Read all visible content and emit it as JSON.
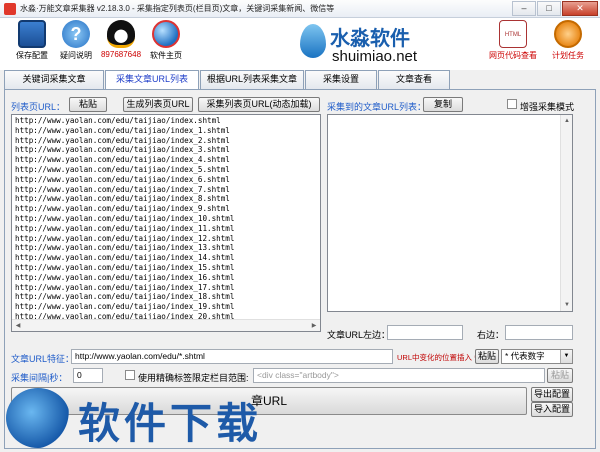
{
  "window": {
    "title": "水淼·万能文章采集器 v2.18.3.0 - 采集指定列表页(栏目页)文章，关键词采集新闻、微信等",
    "minimize": "–",
    "maximize": "□",
    "close": "✕"
  },
  "toolbar": {
    "save": "保存配置",
    "help": "疑问说明",
    "qq": "897687648",
    "home": "软件主页",
    "source": "网页代码查看",
    "schedule": "计划任务"
  },
  "brand": {
    "cn": "水淼软件",
    "en": "shuimiao.net"
  },
  "tabs": [
    {
      "label": "关键词采集文章"
    },
    {
      "label": "采集文章URL列表"
    },
    {
      "label": "根据URL列表采集文章"
    },
    {
      "label": "采集设置"
    },
    {
      "label": "文章查看"
    }
  ],
  "left": {
    "list_label": "列表页URL：",
    "paste_btn": "粘贴",
    "gen_btn": "生成列表页URL",
    "collect_btn": "采集列表页URL(动态加载)",
    "urls": [
      "http://www.yaolan.com/edu/taijiao/index.shtml",
      "http://www.yaolan.com/edu/taijiao/index_1.shtml",
      "http://www.yaolan.com/edu/taijiao/index_2.shtml",
      "http://www.yaolan.com/edu/taijiao/index_3.shtml",
      "http://www.yaolan.com/edu/taijiao/index_4.shtml",
      "http://www.yaolan.com/edu/taijiao/index_5.shtml",
      "http://www.yaolan.com/edu/taijiao/index_6.shtml",
      "http://www.yaolan.com/edu/taijiao/index_7.shtml",
      "http://www.yaolan.com/edu/taijiao/index_8.shtml",
      "http://www.yaolan.com/edu/taijiao/index_9.shtml",
      "http://www.yaolan.com/edu/taijiao/index_10.shtml",
      "http://www.yaolan.com/edu/taijiao/index_11.shtml",
      "http://www.yaolan.com/edu/taijiao/index_12.shtml",
      "http://www.yaolan.com/edu/taijiao/index_13.shtml",
      "http://www.yaolan.com/edu/taijiao/index_14.shtml",
      "http://www.yaolan.com/edu/taijiao/index_15.shtml",
      "http://www.yaolan.com/edu/taijiao/index_16.shtml",
      "http://www.yaolan.com/edu/taijiao/index_17.shtml",
      "http://www.yaolan.com/edu/taijiao/index_18.shtml",
      "http://www.yaolan.com/edu/taijiao/index_19.shtml",
      "http://www.yaolan.com/edu/taijiao/index_20.shtml"
    ]
  },
  "right": {
    "collected_label": "采集到的文章URL列表：",
    "copy_btn": "复制",
    "enhance_label": "增强采集模式",
    "left_edge_label": "文章URL左边：",
    "right_label": "右边："
  },
  "bottom": {
    "feature_label": "文章URL特征：",
    "feature_value": "http://www.yaolan.com/edu/*.shtml",
    "hint": "URL中变化的位置插入 *",
    "paste_btn": "粘贴",
    "select_value": "* 代表数字",
    "interval_label": "采集间隔|秒：",
    "interval_value": "0",
    "precise_label": "使用精确标签限定栏目范围:",
    "precise_placeholder": "<div class=\"artbody\">",
    "paste2_btn": "粘贴",
    "start_btn": "章URL",
    "export_btn": "导出配置",
    "import_btn": "导入配置"
  },
  "watermark": {
    "text": "软件下载"
  },
  "colors": {
    "accent_blue": "#1f5cc9",
    "hint_red": "#c00000",
    "brand_blue": "#1a5fae"
  }
}
